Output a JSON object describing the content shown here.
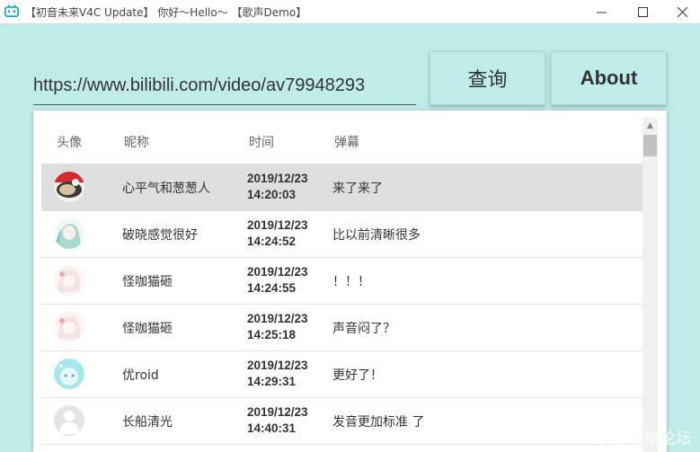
{
  "window": {
    "title": "【初音未来V4C Update】 你好～Hello～ 【歌声Demo】",
    "minimize_glyph": "—",
    "maximize_glyph": "☐",
    "close_glyph": "✕"
  },
  "search": {
    "url_value": "https://www.bilibili.com/video/av79948293"
  },
  "buttons": {
    "query_label": "查询",
    "about_label": "About"
  },
  "table": {
    "headers": {
      "avatar": "头像",
      "nickname": "昵称",
      "time": "时间",
      "danmu": "弹幕"
    },
    "rows": [
      {
        "nickname": "心平气和葱葱人",
        "date": "2019/12/23",
        "time": "14:20:03",
        "danmu": "来了来了",
        "selected": true
      },
      {
        "nickname": "破晓感觉很好",
        "date": "2019/12/23",
        "time": "14:24:52",
        "danmu": "比以前清晰很多",
        "selected": false
      },
      {
        "nickname": "怪咖猫砸",
        "date": "2019/12/23",
        "time": "14:24:55",
        "danmu": "！！！",
        "selected": false
      },
      {
        "nickname": "怪咖猫砸",
        "date": "2019/12/23",
        "time": "14:25:18",
        "danmu": "声音闷了？",
        "selected": false
      },
      {
        "nickname": "优roid",
        "date": "2019/12/23",
        "time": "14:29:31",
        "danmu": "更好了！",
        "selected": false
      },
      {
        "nickname": "长船清光",
        "date": "2019/12/23",
        "time": "14:40:31",
        "danmu": "发音更加标准 了",
        "selected": false
      }
    ]
  },
  "colors": {
    "background": "#bfece8",
    "selected_row": "#dedede",
    "app_icon": "#00a1d6"
  },
  "icons": [
    "bilibili-tv-icon",
    "minimize-icon",
    "maximize-icon",
    "close-icon",
    "scroll-up-arrow-icon"
  ],
  "watermark": "表滑旅暗论坛"
}
